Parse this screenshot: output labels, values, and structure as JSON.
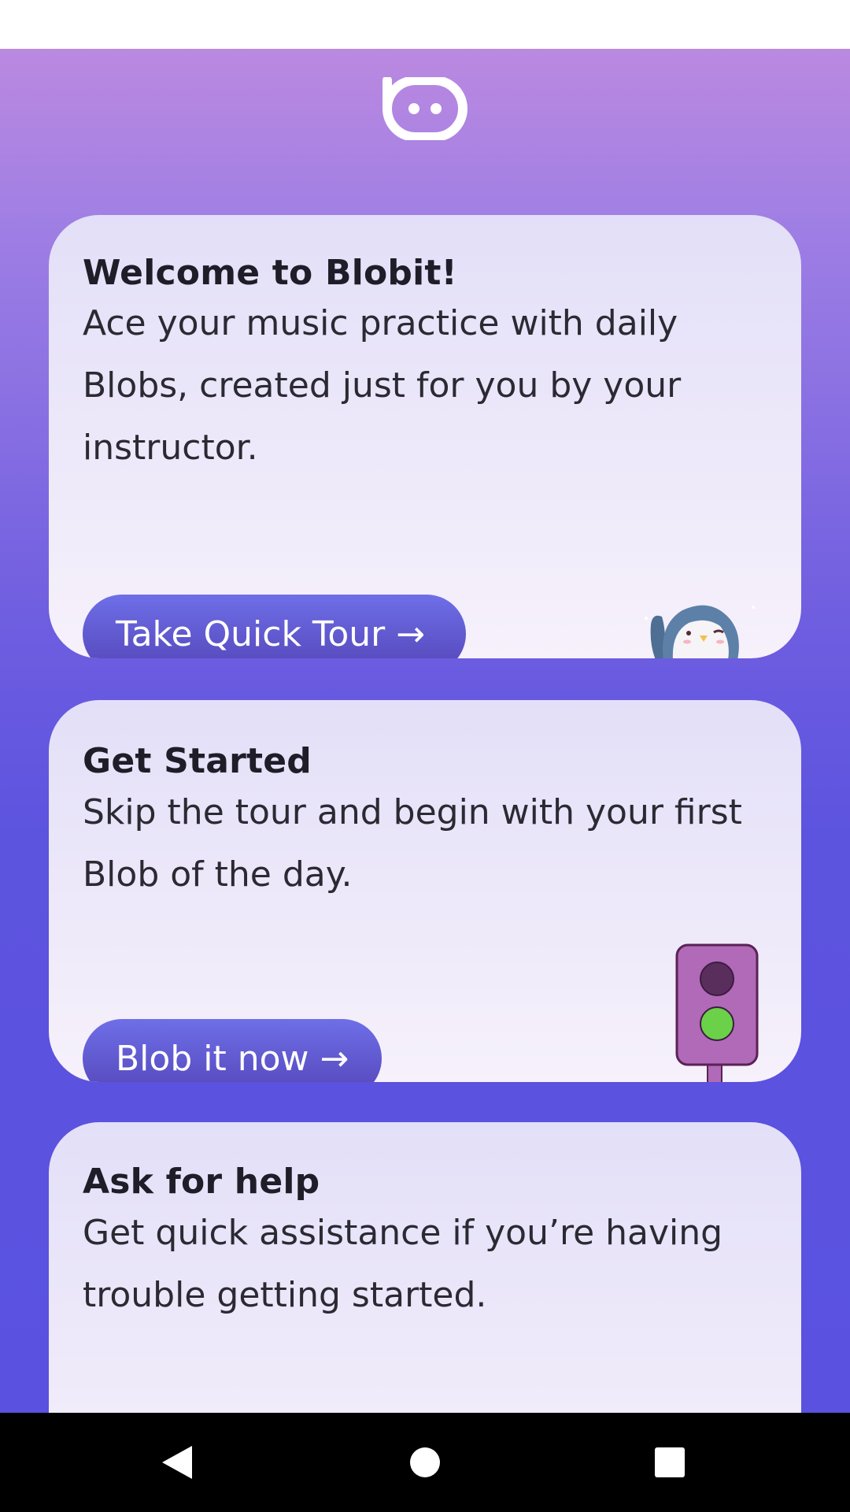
{
  "welcome_card": {
    "title": "Welcome to Blobit!",
    "text": "Ace your music practice with daily Blobs, created just for you by your instructor.",
    "button_label": "Take Quick Tour →"
  },
  "start_card": {
    "title": "Get Started",
    "text": "Skip the tour and begin with your first Blob of the day.",
    "button_label": "Blob it now →"
  },
  "help_card": {
    "title": "Ask for help",
    "text": "Get quick assistance if you’re having trouble getting started.",
    "button_label": ""
  },
  "icons": {
    "logo": "blobit-logo-icon",
    "welcome_illustration": "waving-penguin-icon",
    "start_illustration": "traffic-light-icon",
    "help_illustration": "raised-hand-icon",
    "nav_back": "back-triangle-icon",
    "nav_home": "home-circle-icon",
    "nav_recents": "recents-square-icon"
  },
  "colors": {
    "gradient_top": "#bb89e0",
    "gradient_bottom": "#5a51e0",
    "button": "#6366e6",
    "card": "#ece8fa"
  }
}
